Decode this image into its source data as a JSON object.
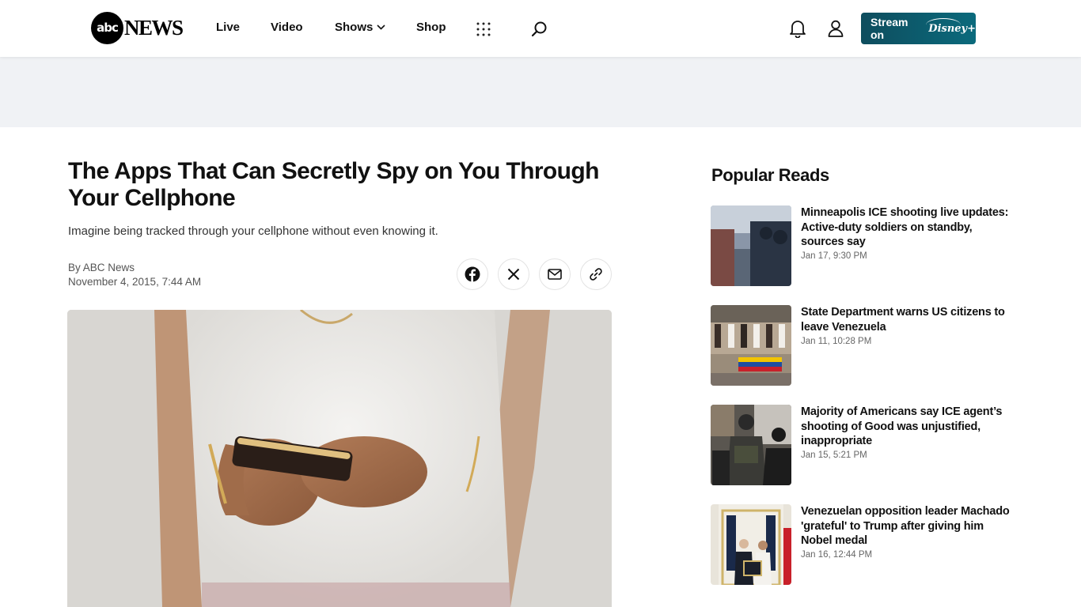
{
  "header": {
    "logo_circle": "abc",
    "logo_text": "NEWS",
    "nav": {
      "live": "Live",
      "video": "Video",
      "shows": "Shows",
      "shop": "Shop"
    },
    "icons": {
      "shows_dropdown": "chevron-down-icon",
      "apps": "grid-icon",
      "search": "search-icon",
      "notifications": "bell-icon",
      "account": "user-icon"
    },
    "stream_label": "Stream on",
    "stream_brand": "Disney+",
    "stream_color": "#0e5a6b"
  },
  "article": {
    "headline": "The Apps That Can Secretly Spy on You Through Your Cellphone",
    "dek": "Imagine being tracked through your cellphone without even knowing it.",
    "byline": "By ABC News",
    "date": "November 4, 2015, 7:44 AM",
    "share_icons": [
      "facebook-icon",
      "x-icon",
      "mail-icon",
      "link-icon"
    ]
  },
  "popular": {
    "title": "Popular Reads",
    "items": [
      {
        "title": "Minneapolis ICE shooting live updates: Active-duty soldiers on standby, sources say",
        "time": "Jan 17, 9:30 PM"
      },
      {
        "title": "State Department warns US citizens to leave Venezuela",
        "time": "Jan 11, 10:28 PM"
      },
      {
        "title": "Majority of Americans say ICE agent’s shooting of Good was unjustified, inappropriate",
        "time": "Jan 15, 5:21 PM"
      },
      {
        "title": "Venezuelan opposition leader Machado 'grateful' to Trump after giving him Nobel medal",
        "time": "Jan 16, 12:44 PM"
      }
    ]
  }
}
